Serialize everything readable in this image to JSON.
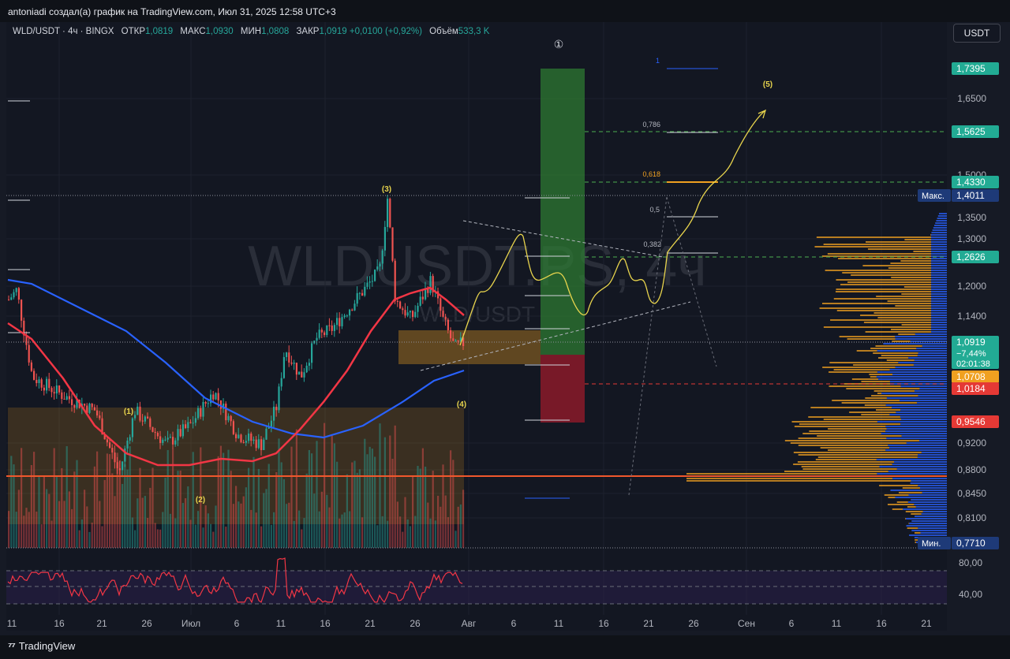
{
  "header": {
    "author_line": "antoniadi создал(а) график на TradingView.com, Июл 31, 2025 12:58 UTC+3",
    "currency_button": "USDT"
  },
  "legend": {
    "symbol": "WLD/USDT · 4ч · BINGX",
    "open_label": "ОТКР",
    "open": "1,0819",
    "high_label": "МАКС",
    "high": "1,0930",
    "low_label": "МИН",
    "low": "1,0808",
    "close_label": "ЗАКР",
    "close": "1,0919",
    "change": "+0,0100 (+0,92%)",
    "volume_label": "Объём",
    "volume": "533,3 K"
  },
  "watermark": {
    "line1": "WLDUSDT.PS, 4ч",
    "line2": "WLD/USDT"
  },
  "footer": {
    "brand": "TradingView"
  },
  "chart_data": {
    "type": "line",
    "symbol": "WLD/USDT",
    "timeframe": "4ч",
    "exchange": "BINGX",
    "y_axis_ticks": [
      "1,6500",
      "1,5000",
      "1,3500",
      "1,3000",
      "1,2000",
      "1,1400",
      "0,9200",
      "0,8800",
      "0,8450",
      "0,8100"
    ],
    "x_axis_ticks": [
      "11",
      "16",
      "21",
      "26",
      "Июл",
      "6",
      "11",
      "16",
      "21",
      "26",
      "Авг",
      "6",
      "11",
      "16",
      "21",
      "26",
      "Сен",
      "6",
      "11",
      "16",
      "21"
    ],
    "price_labels": [
      {
        "text": "1,7395",
        "color": "#22ab94"
      },
      {
        "text": "1,5625",
        "color": "#22ab94"
      },
      {
        "text": "1,4330",
        "color": "#22ab94"
      },
      {
        "text": "1,4011",
        "prefix": "Макс.",
        "color": "#1e3a78"
      },
      {
        "text": "1,2626",
        "color": "#22ab94"
      },
      {
        "text": "1,0919",
        "sub1": "−7,44%",
        "sub2": "02:01:38",
        "color": "#22ab94"
      },
      {
        "text": "1,0708",
        "color": "#f0a020"
      },
      {
        "text": "1,0184",
        "color": "#e53935"
      },
      {
        "text": "0,9546",
        "color": "#e53935"
      },
      {
        "text": "0,7710",
        "prefix": "Мин.",
        "color": "#1e3a78"
      }
    ],
    "current_price": 1.0919,
    "high": 1.4011,
    "low": 0.771,
    "horizontal_line": 0.87,
    "elliott_wave_labels": [
      "(1)",
      "(2)",
      "(3)",
      "(4)",
      "(5)"
    ],
    "cycle_label": "①",
    "fibonacci_levels": [
      "1",
      "0,786",
      "0,618",
      "0,5",
      "0,382"
    ],
    "long_position": {
      "entry": 1.0708,
      "target": 1.7395,
      "stop": 0.9546
    },
    "rsi": {
      "ticks": [
        "80,00",
        "40,00"
      ]
    },
    "series": [
      {
        "name": "MA red",
        "color": "#f23645"
      },
      {
        "name": "MA blue",
        "color": "#2962ff"
      }
    ]
  }
}
